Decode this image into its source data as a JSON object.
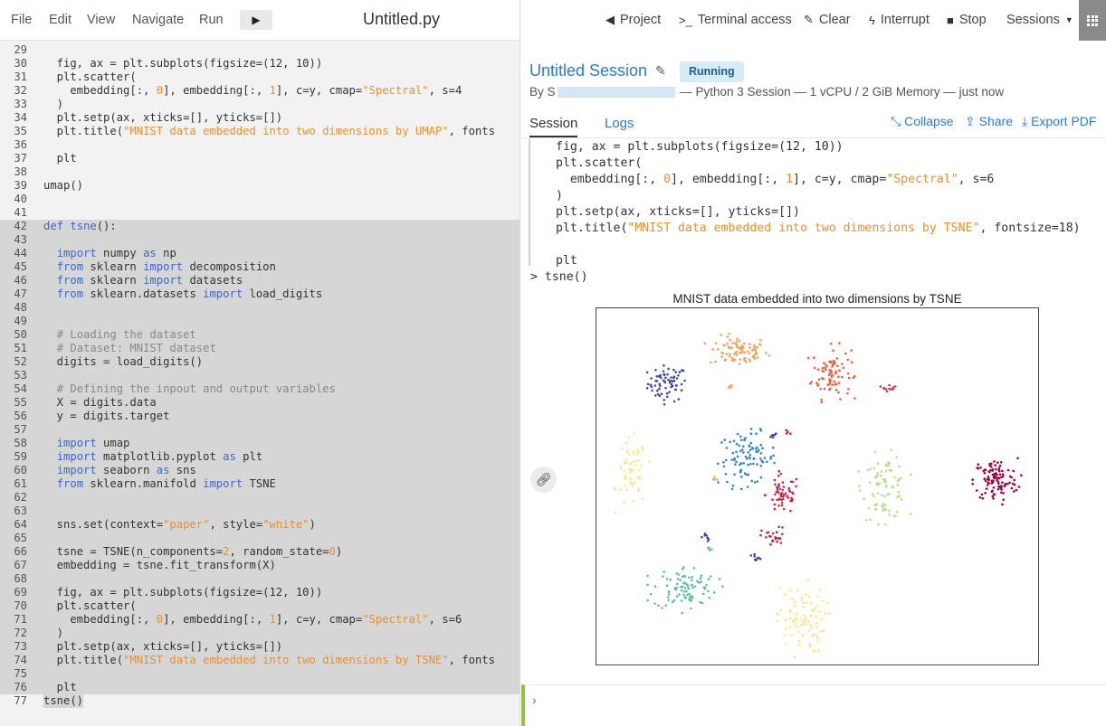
{
  "menu": {
    "file": "File",
    "edit": "Edit",
    "view": "View",
    "navigate": "Navigate",
    "run": "Run",
    "run_button": "▶",
    "file_title": "Untitled.py"
  },
  "editor": {
    "selected_from": 42,
    "selected_to": 77,
    "lines": [
      {
        "n": "29",
        "tokens": []
      },
      {
        "n": "30",
        "tokens": [
          [
            "",
            "  fig, ax = plt.subplots(figsize=(12, 10))"
          ]
        ]
      },
      {
        "n": "31",
        "tokens": [
          [
            "",
            "  plt.scatter("
          ]
        ]
      },
      {
        "n": "32",
        "tokens": [
          [
            "",
            "    embedding[:, "
          ],
          [
            "st",
            "0"
          ],
          [
            "",
            "], embedding[:, "
          ],
          [
            "st",
            "1"
          ],
          [
            "",
            "], c=y, cmap="
          ],
          [
            "st",
            "\"Spectral\""
          ],
          [
            "",
            ", s=4"
          ]
        ]
      },
      {
        "n": "33",
        "tokens": [
          [
            "",
            "  )"
          ]
        ]
      },
      {
        "n": "34",
        "tokens": [
          [
            "",
            "  plt.setp(ax, xticks=[], yticks=[])"
          ]
        ]
      },
      {
        "n": "35",
        "tokens": [
          [
            "",
            "  plt.title("
          ],
          [
            "st",
            "\"MNIST data embedded into two dimensions by UMAP\""
          ],
          [
            "",
            ", fonts"
          ]
        ]
      },
      {
        "n": "36",
        "tokens": []
      },
      {
        "n": "37",
        "tokens": [
          [
            "",
            "  plt"
          ]
        ]
      },
      {
        "n": "38",
        "tokens": []
      },
      {
        "n": "39",
        "tokens": [
          [
            "",
            "umap()"
          ]
        ]
      },
      {
        "n": "40",
        "tokens": []
      },
      {
        "n": "41",
        "tokens": []
      },
      {
        "n": "42",
        "tokens": [
          [
            "kw",
            "def"
          ],
          [
            "",
            " "
          ],
          [
            "nm",
            "tsne"
          ],
          [
            "",
            "():"
          ]
        ]
      },
      {
        "n": "43",
        "tokens": []
      },
      {
        "n": "44",
        "tokens": [
          [
            "",
            "  "
          ],
          [
            "kw",
            "import"
          ],
          [
            "",
            " numpy "
          ],
          [
            "kw",
            "as"
          ],
          [
            "",
            " np"
          ]
        ]
      },
      {
        "n": "45",
        "tokens": [
          [
            "",
            "  "
          ],
          [
            "kw",
            "from"
          ],
          [
            "",
            " sklearn "
          ],
          [
            "kw",
            "import"
          ],
          [
            "",
            " decomposition"
          ]
        ]
      },
      {
        "n": "46",
        "tokens": [
          [
            "",
            "  "
          ],
          [
            "kw",
            "from"
          ],
          [
            "",
            " sklearn "
          ],
          [
            "kw",
            "import"
          ],
          [
            "",
            " datasets"
          ]
        ]
      },
      {
        "n": "47",
        "tokens": [
          [
            "",
            "  "
          ],
          [
            "kw",
            "from"
          ],
          [
            "",
            " sklearn.datasets "
          ],
          [
            "kw",
            "import"
          ],
          [
            "",
            " load_digits"
          ]
        ]
      },
      {
        "n": "48",
        "tokens": []
      },
      {
        "n": "49",
        "tokens": []
      },
      {
        "n": "50",
        "tokens": [
          [
            "",
            "  "
          ],
          [
            "cm",
            "# Loading the dataset"
          ]
        ]
      },
      {
        "n": "51",
        "tokens": [
          [
            "",
            "  "
          ],
          [
            "cm",
            "# Dataset: MNIST dataset"
          ]
        ]
      },
      {
        "n": "52",
        "tokens": [
          [
            "",
            "  digits = load_digits()"
          ]
        ]
      },
      {
        "n": "53",
        "tokens": []
      },
      {
        "n": "54",
        "tokens": [
          [
            "",
            "  "
          ],
          [
            "cm",
            "# Defining the inpout and output variables"
          ]
        ]
      },
      {
        "n": "55",
        "tokens": [
          [
            "",
            "  X = digits.data"
          ]
        ]
      },
      {
        "n": "56",
        "tokens": [
          [
            "",
            "  y = digits.target"
          ]
        ]
      },
      {
        "n": "57",
        "tokens": []
      },
      {
        "n": "58",
        "tokens": [
          [
            "",
            "  "
          ],
          [
            "kw",
            "import"
          ],
          [
            "",
            " umap"
          ]
        ]
      },
      {
        "n": "59",
        "tokens": [
          [
            "",
            "  "
          ],
          [
            "kw",
            "import"
          ],
          [
            "",
            " matplotlib.pyplot "
          ],
          [
            "kw",
            "as"
          ],
          [
            "",
            " plt"
          ]
        ]
      },
      {
        "n": "60",
        "tokens": [
          [
            "",
            "  "
          ],
          [
            "kw",
            "import"
          ],
          [
            "",
            " seaborn "
          ],
          [
            "kw",
            "as"
          ],
          [
            "",
            " sns"
          ]
        ]
      },
      {
        "n": "61",
        "tokens": [
          [
            "",
            "  "
          ],
          [
            "kw",
            "from"
          ],
          [
            "",
            " sklearn.manifold "
          ],
          [
            "kw",
            "import"
          ],
          [
            "",
            " TSNE"
          ]
        ]
      },
      {
        "n": "62",
        "tokens": []
      },
      {
        "n": "63",
        "tokens": []
      },
      {
        "n": "64",
        "tokens": [
          [
            "",
            "  sns.set(context="
          ],
          [
            "st",
            "\"paper\""
          ],
          [
            "",
            ", style="
          ],
          [
            "st",
            "\"white\""
          ],
          [
            "",
            ")"
          ]
        ]
      },
      {
        "n": "65",
        "tokens": []
      },
      {
        "n": "66",
        "tokens": [
          [
            "",
            "  tsne = TSNE(n_components="
          ],
          [
            "st",
            "2"
          ],
          [
            "",
            ", random_state="
          ],
          [
            "st",
            "0"
          ],
          [
            "",
            ")"
          ]
        ]
      },
      {
        "n": "67",
        "tokens": [
          [
            "",
            "  embedding = tsne.fit_transform(X)"
          ]
        ]
      },
      {
        "n": "68",
        "tokens": []
      },
      {
        "n": "69",
        "tokens": [
          [
            "",
            "  fig, ax = plt.subplots(figsize=(12, 10))"
          ]
        ]
      },
      {
        "n": "70",
        "tokens": [
          [
            "",
            "  plt.scatter("
          ]
        ]
      },
      {
        "n": "71",
        "tokens": [
          [
            "",
            "    embedding[:, "
          ],
          [
            "st",
            "0"
          ],
          [
            "",
            "], embedding[:, "
          ],
          [
            "st",
            "1"
          ],
          [
            "",
            "], c=y, cmap="
          ],
          [
            "st",
            "\"Spectral\""
          ],
          [
            "",
            ", s=6"
          ]
        ]
      },
      {
        "n": "72",
        "tokens": [
          [
            "",
            "  )"
          ]
        ]
      },
      {
        "n": "73",
        "tokens": [
          [
            "",
            "  plt.setp(ax, xticks=[], yticks=[])"
          ]
        ]
      },
      {
        "n": "74",
        "tokens": [
          [
            "",
            "  plt.title("
          ],
          [
            "st",
            "\"MNIST data embedded into two dimensions by TSNE\""
          ],
          [
            "",
            ", fonts"
          ]
        ]
      },
      {
        "n": "75",
        "tokens": []
      },
      {
        "n": "76",
        "tokens": [
          [
            "",
            "  plt"
          ]
        ]
      },
      {
        "n": "77",
        "tokens": [
          [
            "",
            "tsne()"
          ]
        ]
      }
    ]
  },
  "topbar": {
    "project": "Project",
    "project_icon": "arrow-left-icon",
    "terminal": "Terminal access",
    "terminal_icon": ">_",
    "clear": "Clear",
    "interrupt": "Interrupt",
    "stop": "Stop",
    "sessions": "Sessions"
  },
  "session": {
    "title": "Untitled Session",
    "status": "Running",
    "meta_prefix": "By S",
    "meta_suffix": " — Python 3 Session — 1 vCPU / 2 GiB Memory — just now",
    "tab_session": "Session",
    "tab_logs": "Logs",
    "collapse": "Collapse",
    "share": "Share",
    "export": "Export PDF"
  },
  "output": {
    "lines": [
      [
        [
          "",
          "fig, ax = plt.subplots(figsize=(12, 10))"
        ]
      ],
      [
        [
          "",
          "plt.scatter("
        ]
      ],
      [
        [
          "",
          "  embedding[:, "
        ],
        [
          "st",
          "0"
        ],
        [
          "",
          "], embedding[:, "
        ],
        [
          "st",
          "1"
        ],
        [
          "",
          "], c=y, cmap="
        ],
        [
          "st",
          "\"Spectral\""
        ],
        [
          "",
          ", s=6"
        ]
      ],
      [
        [
          "",
          ")"
        ]
      ],
      [
        [
          "",
          "plt.setp(ax, xticks=[], yticks=[])"
        ]
      ],
      [
        [
          "",
          "plt.title("
        ],
        [
          "st",
          "\"MNIST data embedded into two dimensions by TSNE\""
        ],
        [
          "",
          ", fontsize=18)"
        ]
      ],
      [],
      [
        [
          "",
          "plt"
        ]
      ]
    ],
    "prompt": "> tsne()"
  },
  "colors": {
    "accent": "#2a7bd1",
    "badge_bg": "#d8ecf8",
    "console_bar": "#8cc63f"
  },
  "chart_data": {
    "type": "scatter",
    "title": "MNIST data embedded into two dimensions by TSNE",
    "xlabel": "",
    "ylabel": "",
    "xlim": [
      0,
      100
    ],
    "ylim": [
      0,
      100
    ],
    "grid": false,
    "clusters": [
      {
        "cx": 16,
        "cy": 79,
        "rx": 4,
        "ry": 4.5,
        "n": 70,
        "color": "#3f4a9a"
      },
      {
        "cx": 32,
        "cy": 88,
        "rx": 6,
        "ry": 3.8,
        "n": 85,
        "color": "#f5a15a"
      },
      {
        "cx": 53,
        "cy": 82,
        "rx": 4,
        "ry": 6.5,
        "n": 85,
        "color": "#e8613c"
      },
      {
        "cx": 66,
        "cy": 78,
        "rx": 1.5,
        "ry": 1,
        "n": 12,
        "color": "#d53e4f"
      },
      {
        "cx": 34,
        "cy": 58,
        "rx": 6,
        "ry": 6.5,
        "n": 95,
        "color": "#2e86ba"
      },
      {
        "cx": 42,
        "cy": 48,
        "rx": 3.5,
        "ry": 5,
        "n": 55,
        "color": "#c8243f"
      },
      {
        "cx": 8,
        "cy": 54,
        "rx": 3,
        "ry": 8.5,
        "n": 60,
        "color": "#f5e98a"
      },
      {
        "cx": 65,
        "cy": 50,
        "rx": 4.5,
        "ry": 8,
        "n": 85,
        "color": "#b7de8a"
      },
      {
        "cx": 90,
        "cy": 52,
        "rx": 4.5,
        "ry": 5.5,
        "n": 110,
        "color": "#9e0142"
      },
      {
        "cx": 20,
        "cy": 22,
        "rx": 6.5,
        "ry": 5.5,
        "n": 95,
        "color": "#62bca6"
      },
      {
        "cx": 46,
        "cy": 13,
        "rx": 5,
        "ry": 8.5,
        "n": 85,
        "color": "#fde57f"
      },
      {
        "cx": 40,
        "cy": 36,
        "rx": 2.5,
        "ry": 2.5,
        "n": 25,
        "color": "#c8243f"
      },
      {
        "cx": 25,
        "cy": 36,
        "rx": 1,
        "ry": 1.2,
        "n": 8,
        "color": "#3f4a9a"
      },
      {
        "cx": 36,
        "cy": 30,
        "rx": 1,
        "ry": 1.2,
        "n": 8,
        "color": "#3f4a9a"
      },
      {
        "cx": 40,
        "cy": 64,
        "rx": 1,
        "ry": 1,
        "n": 6,
        "color": "#3f4a9a"
      },
      {
        "cx": 43,
        "cy": 65.5,
        "rx": 0.6,
        "ry": 1,
        "n": 4,
        "color": "#c8243f"
      },
      {
        "cx": 30,
        "cy": 78,
        "rx": 0.8,
        "ry": 0.6,
        "n": 5,
        "color": "#f5a15a"
      },
      {
        "cx": 27,
        "cy": 52,
        "rx": 0.8,
        "ry": 1,
        "n": 4,
        "color": "#f5a15a"
      },
      {
        "cx": 25.5,
        "cy": 33,
        "rx": 0.8,
        "ry": 0.6,
        "n": 4,
        "color": "#62bca6"
      }
    ]
  }
}
